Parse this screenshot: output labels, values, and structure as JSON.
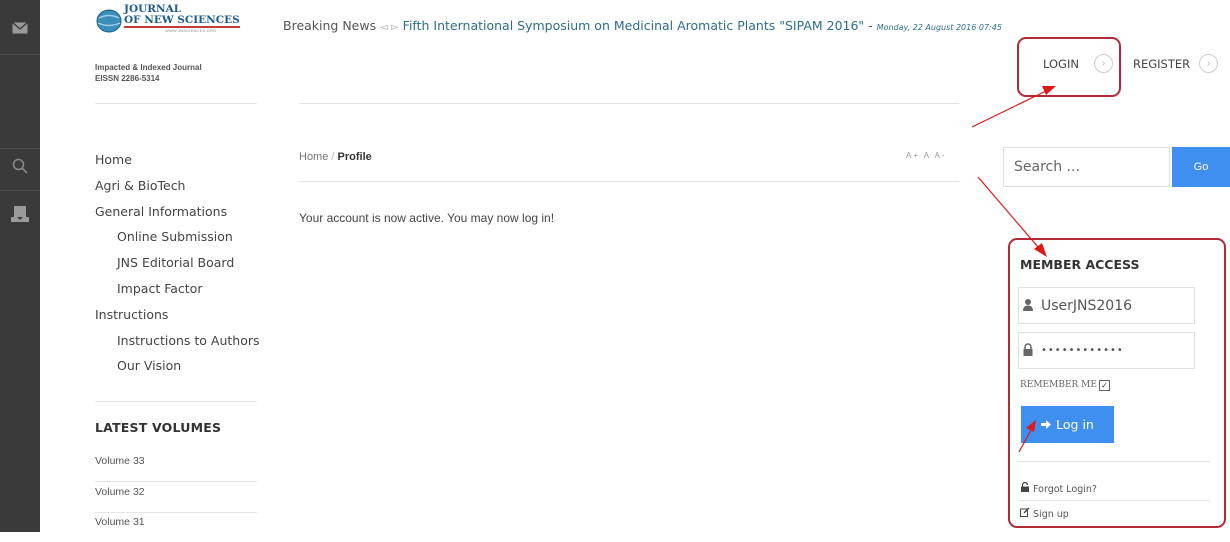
{
  "logo": {
    "line1": "JOURNAL",
    "line2": "OF NEW SCIENCES",
    "url": "WWW.JNSCIENCES.ORG"
  },
  "tagline": {
    "line1": "Impacted & Indexed Journal",
    "line2": "EISSN 2286-5314"
  },
  "news": {
    "label": "Breaking News",
    "headline": "Fifth International Symposium on Medicinal Aromatic Plants \"SIPAM 2016\"",
    "date": "Monday, 22 August 2016 07:45"
  },
  "auth": {
    "login": "LOGIN",
    "register": "REGISTER"
  },
  "nav": {
    "items": [
      {
        "label": "Home"
      },
      {
        "label": "Agri & BioTech"
      },
      {
        "label": "General Informations"
      },
      {
        "label": "Online Submission"
      },
      {
        "label": "JNS Editorial Board"
      },
      {
        "label": "Impact Factor"
      },
      {
        "label": "Instructions"
      },
      {
        "label": "Instructions to Authors"
      },
      {
        "label": "Our Vision"
      }
    ]
  },
  "latest": {
    "title": "LATEST VOLUMES",
    "volumes": [
      "Volume 33",
      "Volume 32",
      "Volume 31"
    ]
  },
  "breadcrumb": {
    "home": "Home",
    "sep": "/",
    "current": "Profile"
  },
  "font_controls": "A+ A A-",
  "message": "Your account is now active. You may now log in!",
  "search": {
    "placeholder": "Search ...",
    "button": "Go"
  },
  "member_access": {
    "title": "MEMBER ACCESS",
    "username": "UserJNS2016",
    "password": "••••••••••••",
    "remember_label": "REMEMBER ME",
    "login_button": "Log in",
    "forgot": "Forgot Login?",
    "signup": "Sign up"
  },
  "colors": {
    "accent": "#3f8ff0",
    "highlight": "#b22a35",
    "rail": "#3a3a3a",
    "arrow": "#e01818"
  },
  "icons": [
    "envelope-icon",
    "search-icon",
    "reader-icon",
    "user-icon",
    "lock-icon",
    "circle-arrow-icon",
    "unlock-icon",
    "edit-icon",
    "sign-in-icon"
  ]
}
